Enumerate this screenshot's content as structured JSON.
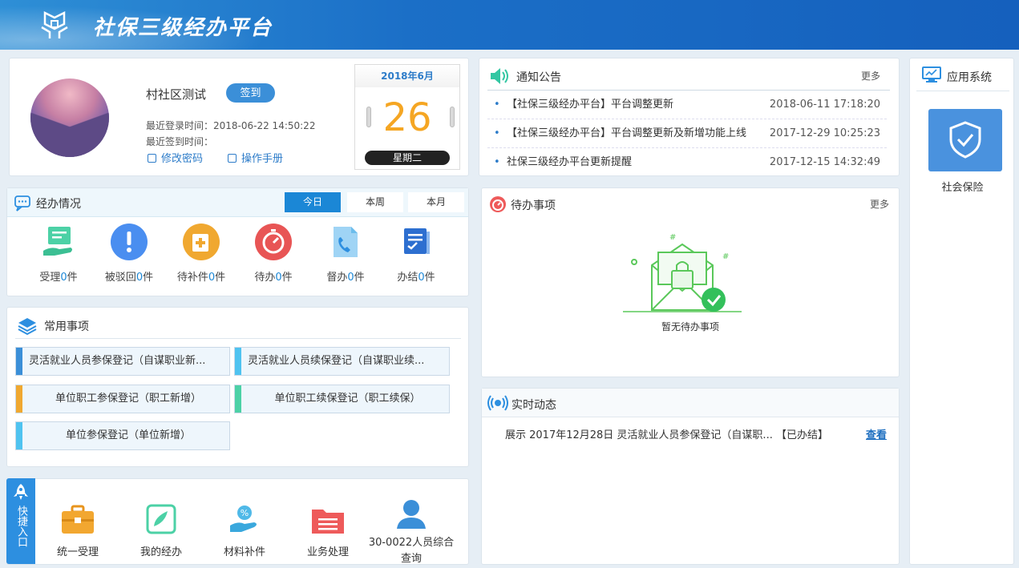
{
  "app": {
    "title": "社保三级经办平台"
  },
  "profile": {
    "username": "村社区测试",
    "signin_label": "签到",
    "last_login": "最近登录时间：2018-06-22 14:50:22",
    "last_signin": "最近签到时间：",
    "change_password": "修改密码",
    "manual": "操作手册"
  },
  "calendar": {
    "month": "2018年6月",
    "day": "26",
    "weekday": "星期二"
  },
  "handling": {
    "title": "经办情况",
    "tabs": [
      "今日",
      "本周",
      "本月"
    ],
    "stats": [
      {
        "label": "受理",
        "count": "0",
        "unit": "件"
      },
      {
        "label": "被驳回",
        "count": "0",
        "unit": "件"
      },
      {
        "label": "待补件",
        "count": "0",
        "unit": "件"
      },
      {
        "label": "待办",
        "count": "0",
        "unit": "件"
      },
      {
        "label": "督办",
        "count": "0",
        "unit": "件"
      },
      {
        "label": "办结",
        "count": "0",
        "unit": "件"
      }
    ]
  },
  "common": {
    "title": "常用事项",
    "items": [
      "灵活就业人员参保登记（自谋职业新...",
      "灵活就业人员续保登记（自谋职业续...",
      "单位职工参保登记（职工新增）",
      "单位职工续保登记（职工续保）",
      "单位参保登记（单位新增）"
    ]
  },
  "quick": {
    "label": "快捷入口",
    "items": [
      "统一受理",
      "我的经办",
      "材料补件",
      "业务处理",
      "30-0022人员综合查询"
    ]
  },
  "notice": {
    "title": "通知公告",
    "more": "更多",
    "rows": [
      {
        "text": "【社保三级经办平台】平台调整更新",
        "date": "2018-06-11 17:18:20"
      },
      {
        "text": "【社保三级经办平台】平台调整更新及新增功能上线",
        "date": "2017-12-29 10:25:23"
      },
      {
        "text": "社保三级经办平台更新提醒",
        "date": "2017-12-15 14:32:49"
      }
    ]
  },
  "todo": {
    "title": "待办事项",
    "more": "更多",
    "empty": "暂无待办事项"
  },
  "realtime": {
    "title": "实时动态",
    "row": "展示 2017年12月28日 灵活就业人员参保登记（自谋职...",
    "status": "【已办结】",
    "view": "查看"
  },
  "apps": {
    "title": "应用系统",
    "tile_label": "社会保险"
  },
  "colors": {
    "header": "#1b6fc7",
    "accent": "#1b87d6",
    "calendar_day": "#f5a623"
  }
}
